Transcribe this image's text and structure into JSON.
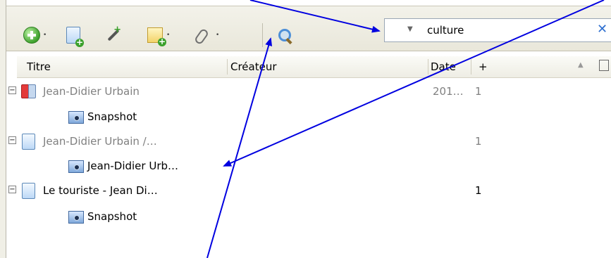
{
  "toolbar": {
    "new_item": "new-item-icon",
    "new_item_from_page": "add-page-icon",
    "add_by_identifier": "magic-wand-icon",
    "new_note": "new-note-icon",
    "add_attachment": "paperclip-icon",
    "advanced_search": "magnifier-icon"
  },
  "search": {
    "value": "culture",
    "clear_symbol": "✕"
  },
  "columns": {
    "title": "Titre",
    "creator": "Créateur",
    "date": "Date",
    "extra": "+"
  },
  "rows": [
    {
      "title": "Jean-Didier Urbain",
      "date": "201…",
      "count": "1",
      "type": "book",
      "grey": true
    },
    {
      "title": "Snapshot",
      "date": "",
      "count": "",
      "type": "snapshot",
      "grey": false
    },
    {
      "title": "Jean-Didier Urbain /…",
      "date": "",
      "count": "1",
      "type": "document",
      "grey": true
    },
    {
      "title": "Jean-Didier Urb…",
      "date": "",
      "count": "",
      "type": "snapshot",
      "grey": false
    },
    {
      "title": "Le touriste - Jean Di…",
      "date": "",
      "count": "1",
      "type": "document",
      "grey": false
    },
    {
      "title": "Snapshot",
      "date": "",
      "count": "",
      "type": "snapshot",
      "grey": false
    }
  ],
  "colors": {
    "arrow": "#0000e0",
    "grey_text": "#808080"
  }
}
